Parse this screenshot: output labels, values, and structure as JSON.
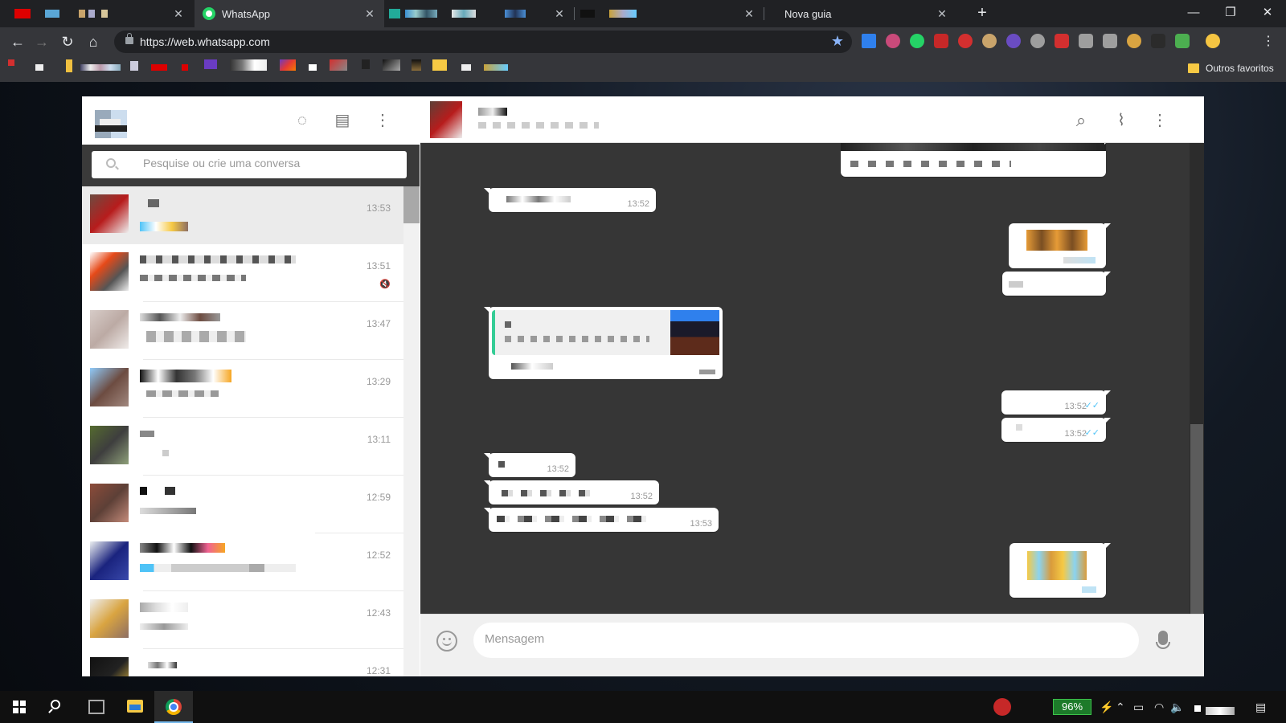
{
  "browser": {
    "tabs": [
      {
        "title": ""
      },
      {
        "title": ""
      },
      {
        "title": "WhatsApp"
      },
      {
        "title": ""
      },
      {
        "title": ""
      },
      {
        "title": "Nova guia"
      }
    ],
    "url": "https://web.whatsapp.com",
    "bookmark_folder": "Outros favoritos"
  },
  "whatsapp": {
    "search_placeholder": "Pesquise ou crie uma conversa",
    "message_placeholder": "Mensagem",
    "chats": [
      {
        "time": "13:53",
        "selected": true,
        "muted": false
      },
      {
        "time": "13:51",
        "selected": false,
        "muted": true
      },
      {
        "time": "13:47",
        "selected": false,
        "muted": false
      },
      {
        "time": "13:29",
        "selected": false,
        "muted": false
      },
      {
        "time": "13:11",
        "selected": false,
        "muted": false
      },
      {
        "time": "12:59",
        "selected": false,
        "muted": false
      },
      {
        "time": "12:52",
        "selected": false,
        "muted": false
      },
      {
        "time": "12:43",
        "selected": false,
        "muted": false
      },
      {
        "time": "12:31",
        "selected": false,
        "muted": false
      }
    ],
    "messages": [
      {
        "dir": "out",
        "time": ""
      },
      {
        "dir": "in",
        "time": "13:52"
      },
      {
        "dir": "out",
        "time": ""
      },
      {
        "dir": "out",
        "time": ""
      },
      {
        "dir": "in",
        "time": ""
      },
      {
        "dir": "out",
        "time": "13:52",
        "read": true
      },
      {
        "dir": "out",
        "time": "13:52",
        "read": true
      },
      {
        "dir": "in",
        "time": "13:52"
      },
      {
        "dir": "in",
        "time": "13:52"
      },
      {
        "dir": "in",
        "time": "13:53"
      },
      {
        "dir": "out",
        "time": ""
      }
    ]
  },
  "taskbar": {
    "battery": "96%"
  },
  "colors": {
    "tab_bg": "#202124",
    "toolbar_bg": "#35363a",
    "chat_bg": "#363636",
    "read_ticks": "#4fc3f7",
    "wa_green": "#25d366"
  }
}
